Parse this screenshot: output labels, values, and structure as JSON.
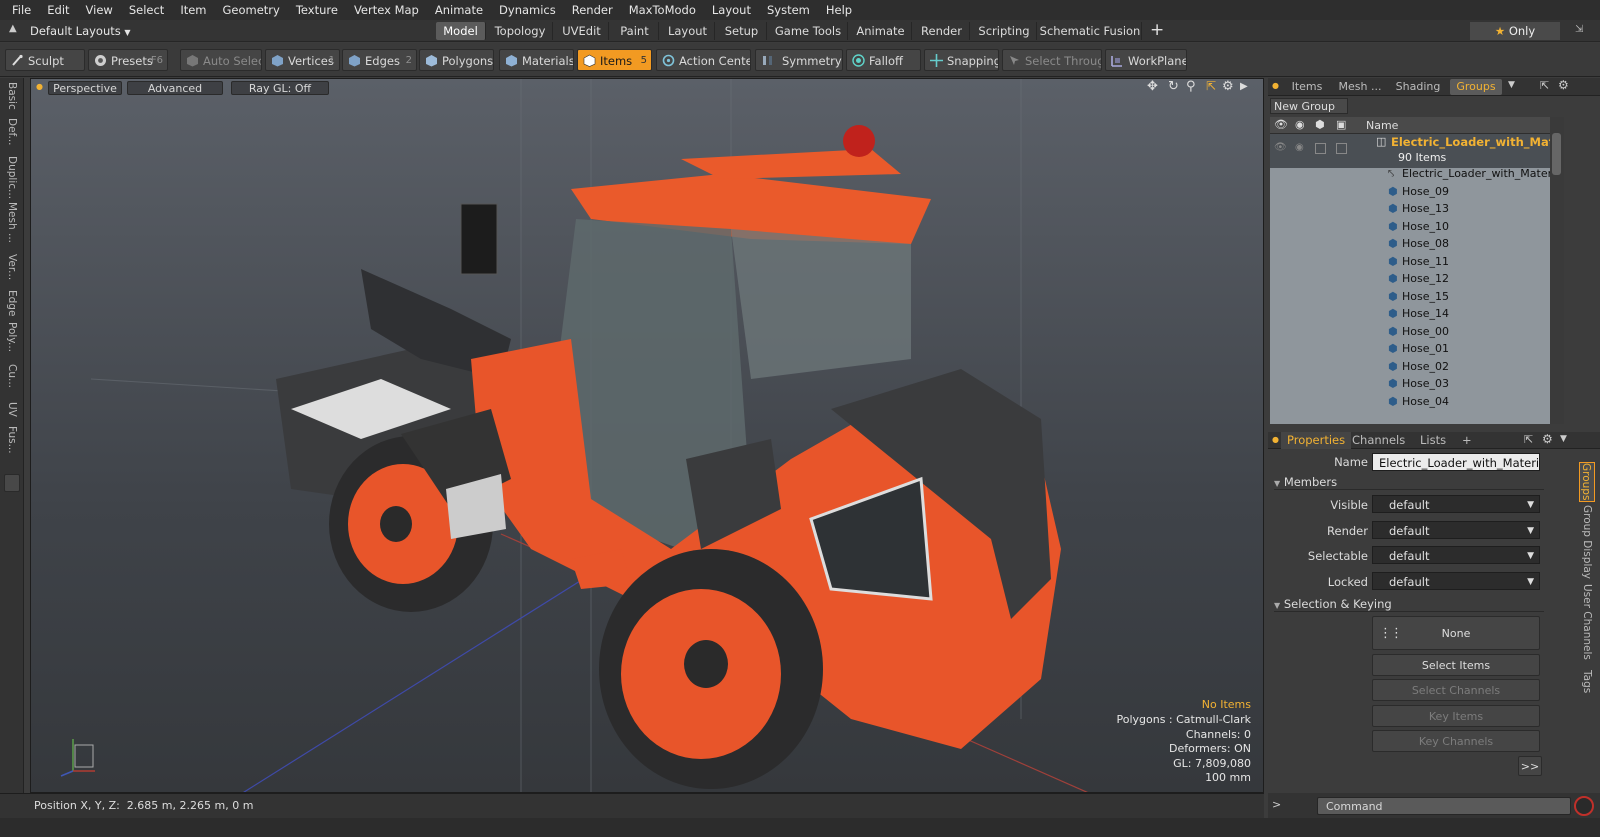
{
  "menu": [
    "File",
    "Edit",
    "View",
    "Select",
    "Item",
    "Geometry",
    "Texture",
    "Vertex Map",
    "Animate",
    "Dynamics",
    "Render",
    "MaxToModo",
    "Layout",
    "System",
    "Help"
  ],
  "layouts": {
    "label": "Default Layouts"
  },
  "tabs": [
    {
      "label": "Model",
      "active": true
    },
    {
      "label": "Topology"
    },
    {
      "label": "UVEdit"
    },
    {
      "label": "Paint"
    },
    {
      "label": "Layout"
    },
    {
      "label": "Setup"
    },
    {
      "label": "Game Tools"
    },
    {
      "label": "Animate"
    },
    {
      "label": "Render"
    },
    {
      "label": "Scripting"
    },
    {
      "label": "Schematic Fusion"
    }
  ],
  "add_tab": "+",
  "only_label": "Only",
  "toolbar": {
    "sculpt": "Sculpt",
    "presets": "Presets",
    "presets_key": "F6",
    "auto_select": "Auto Select",
    "vertices": "Vertices",
    "vertices_key": "1",
    "edges": "Edges",
    "edges_key": "2",
    "polygons": "Polygons",
    "materials": "Materials",
    "items": "Items",
    "items_key": "5",
    "action_center": "Action Center",
    "symmetry": "Symmetry",
    "falloff": "Falloff",
    "snapping": "Snapping",
    "select_through": "Select Through",
    "workplane": "WorkPlane"
  },
  "left_tabs": [
    "Basic",
    "Def...",
    "Duplic...",
    "Mesh ...",
    "Ver...",
    "Edge",
    "Poly...",
    "Cu...",
    "UV",
    "Fus..."
  ],
  "viewport": {
    "perspective": "Perspective",
    "advanced": "Advanced",
    "raygl": "Ray GL: Off",
    "info": {
      "no_items": "No Items",
      "polygons": "Polygons : Catmull-Clark",
      "channels": "Channels: 0",
      "deformers": "Deformers: ON",
      "gl": "GL: 7,809,080",
      "units": "100 mm"
    }
  },
  "right_tabs": [
    {
      "label": "Items"
    },
    {
      "label": "Mesh ..."
    },
    {
      "label": "Shading"
    },
    {
      "label": "Groups",
      "active": true
    }
  ],
  "groups": {
    "new_group": "New Group",
    "col_name": "Name",
    "root": "Electric_Loader_with_Mat...",
    "count": "90 Items",
    "items": [
      "Electric_Loader_with_Materi...",
      "Hose_09",
      "Hose_13",
      "Hose_10",
      "Hose_08",
      "Hose_11",
      "Hose_12",
      "Hose_15",
      "Hose_14",
      "Hose_00",
      "Hose_01",
      "Hose_02",
      "Hose_03",
      "Hose_04"
    ]
  },
  "prop_tabs": [
    {
      "label": "Properties",
      "active": true
    },
    {
      "label": "Channels"
    },
    {
      "label": "Lists"
    },
    {
      "label": "+"
    }
  ],
  "properties": {
    "name_label": "Name",
    "name_value": "Electric_Loader_with_Material_Ha",
    "members": "Members",
    "visible_label": "Visible",
    "visible": "default",
    "render_label": "Render",
    "render": "default",
    "selectable_label": "Selectable",
    "selectable": "default",
    "locked_label": "Locked",
    "locked": "default",
    "sel_keying": "Selection & Keying",
    "none": "None",
    "select_items": "Select Items",
    "select_channels": "Select Channels",
    "key_items": "Key Items",
    "key_channels": "Key Channels",
    "more": ">>"
  },
  "right_vtabs": [
    {
      "label": "Groups",
      "active": true
    },
    {
      "label": "Group Display"
    },
    {
      "label": "User Channels"
    },
    {
      "label": "Tags"
    }
  ],
  "status": {
    "position": "Position X, Y, Z:  2.685 m, 2.265 m, 0 m"
  },
  "command": {
    "placeholder": "Command"
  },
  "colors": {
    "accent": "#f29a22",
    "orange_body": "#e8552a",
    "group_bg": "#8f969c"
  }
}
